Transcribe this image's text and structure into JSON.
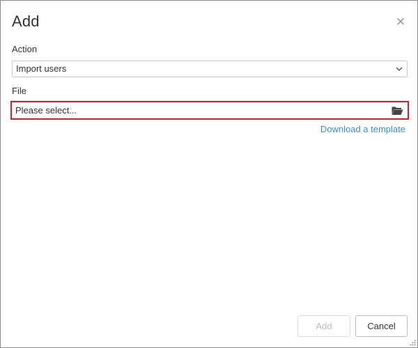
{
  "dialog": {
    "title": "Add",
    "close_icon": "close-icon"
  },
  "form": {
    "action_label": "Action",
    "action_value": "Import users",
    "file_label": "File",
    "file_placeholder": "Please select...",
    "folder_icon": "folder-open-icon",
    "template_link": "Download a template"
  },
  "footer": {
    "add_label": "Add",
    "cancel_label": "Cancel"
  },
  "colors": {
    "highlight_border": "#e01b24",
    "link": "#3a8ed0",
    "dialog_border": "#8a8a8a"
  }
}
